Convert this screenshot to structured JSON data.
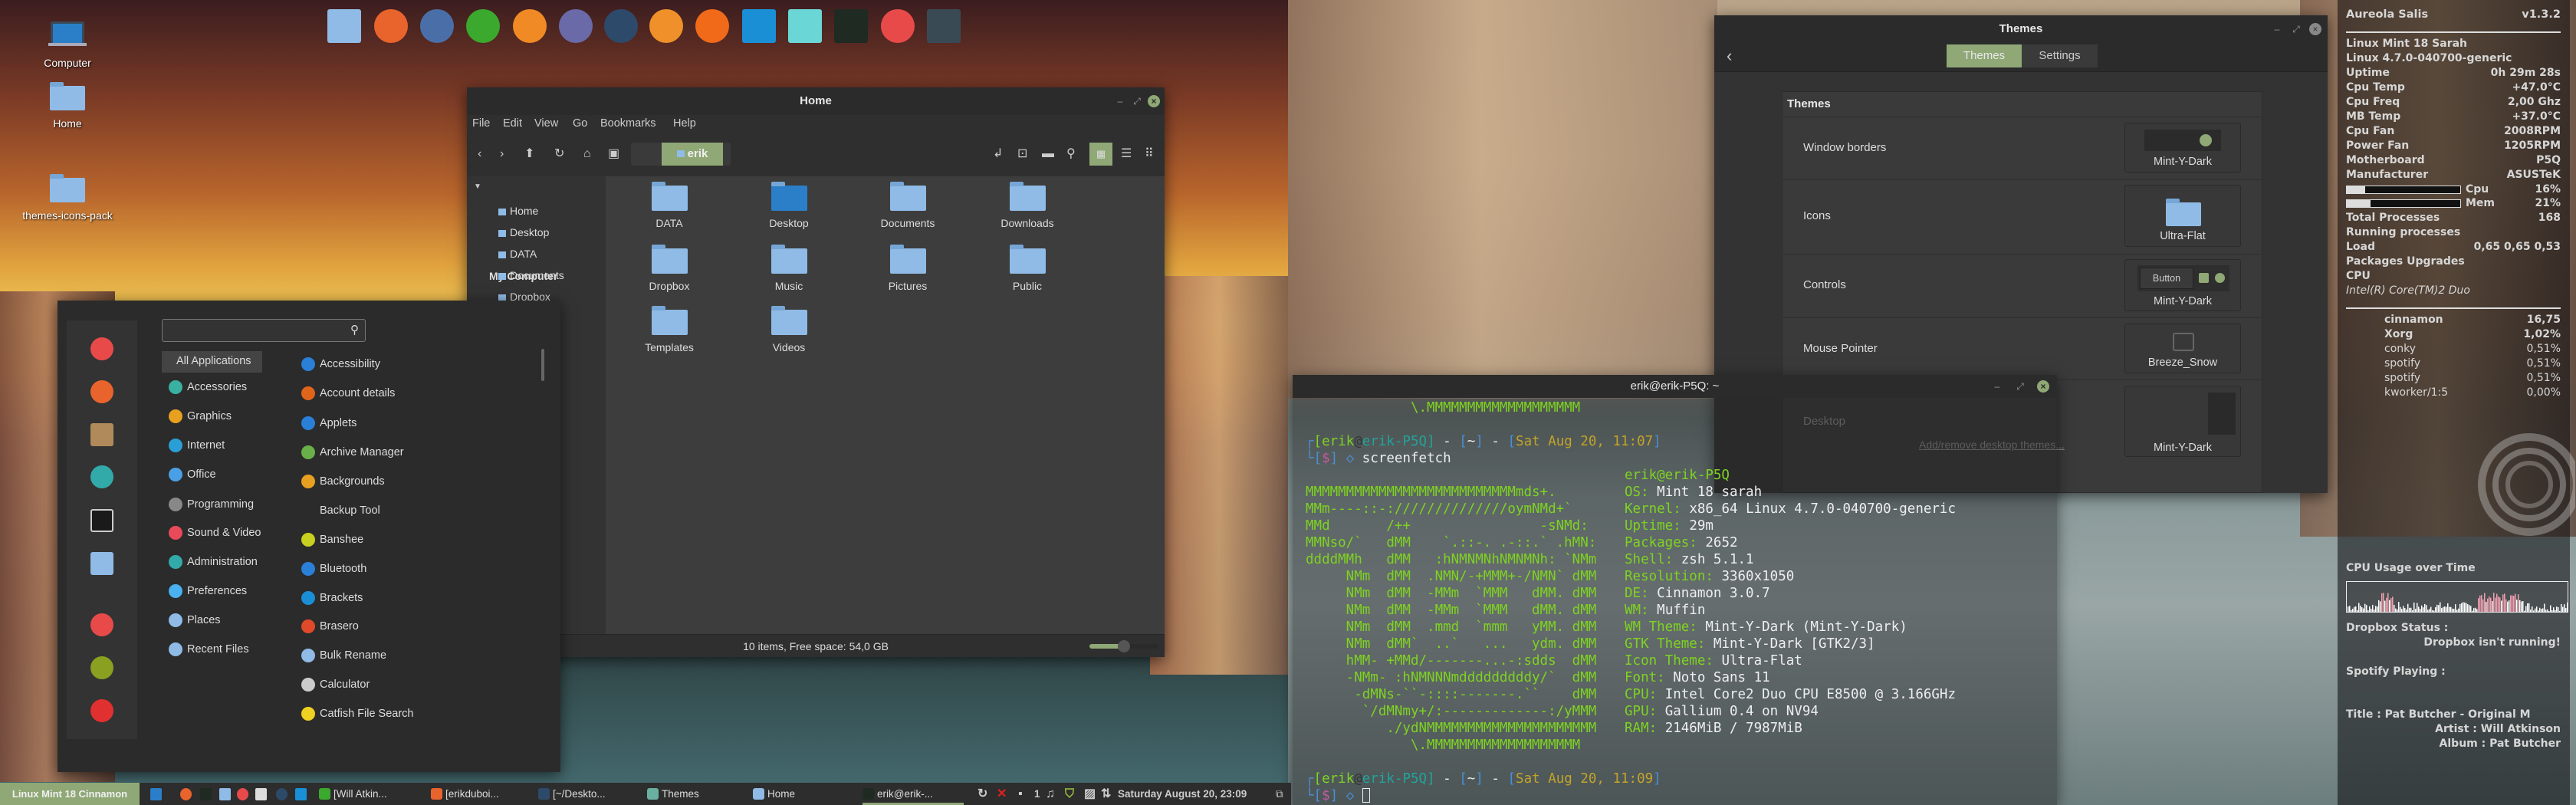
{
  "desktop_icons": [
    {
      "label": "Computer",
      "icon": "laptop-icon"
    },
    {
      "label": "Home",
      "icon": "home-folder-icon"
    },
    {
      "label": "themes-icons-pack",
      "icon": "folder-icon"
    }
  ],
  "dock": {
    "icons": [
      "files-icon",
      "firefox-icon",
      "text-editor-icon",
      "spotify-icon",
      "gimp-icon",
      "inkscape-icon",
      "sublime-text-icon",
      "clementine-icon",
      "vlc-icon",
      "brackets-icon",
      "screenshot-icon",
      "system-monitor-icon",
      "chromium-icon",
      "terminal-icon"
    ],
    "colors": [
      "#8fbbe6",
      "#e8642c",
      "#4a6fa8",
      "#3ba82e",
      "#f08a24",
      "#6a6aa8",
      "#2e4a6a",
      "#f0902a",
      "#f06a1a",
      "#1a8fd6",
      "#6ad6d6",
      "#1e2a22",
      "#e84a4a",
      "#3a4a55"
    ]
  },
  "file_manager": {
    "title": "Home",
    "menu": [
      "File",
      "Edit",
      "View",
      "Go",
      "Bookmarks",
      "Help"
    ],
    "path_button": "erik",
    "sidebar_header": "My Computer",
    "sidebar_items": [
      "Home",
      "Desktop",
      "DATA",
      "Documents",
      "Dropbox"
    ],
    "items": [
      "DATA",
      "Desktop",
      "Documents",
      "Downloads",
      "Dropbox",
      "Music",
      "Pictures",
      "Public",
      "Templates",
      "Videos"
    ],
    "status": "10 items, Free space: 54,0 GB",
    "zoom_level_percent": 50,
    "accent": "#8fa876"
  },
  "menu": {
    "search_placeholder": "",
    "favorites": [
      "chromium-icon",
      "firefox-icon",
      "package-manager-icon",
      "settings-icon",
      "terminal-icon",
      "files-icon",
      "lock-screen-icon",
      "logout-icon",
      "shutdown-icon"
    ],
    "categories": [
      "All Applications",
      "Accessories",
      "Graphics",
      "Internet",
      "Office",
      "Programming",
      "Sound & Video",
      "Administration",
      "Preferences",
      "Places",
      "Recent Files"
    ],
    "apps": [
      "Accessibility",
      "Account details",
      "Applets",
      "Archive Manager",
      "Backgrounds",
      "Backup Tool",
      "Banshee",
      "Bluetooth",
      "Brackets",
      "Brasero",
      "Bulk Rename",
      "Calculator",
      "Catfish File Search"
    ]
  },
  "terminal": {
    "title": "erik@erik-P5Q: ~",
    "previous_output": "             \\.MMMMMMMMMMMMMMMMMMM",
    "prompts": [
      {
        "user": "erik",
        "at": "@",
        "host": "erik-P5Q",
        "dir": "~",
        "time": "Sat Aug 20, 11:07",
        "symbol": "$",
        "command": "screenfetch"
      },
      {
        "user": "erik",
        "at": "@",
        "host": "erik-P5Q",
        "dir": "~",
        "time": "Sat Aug 20, 11:09",
        "symbol": "$",
        "command": ""
      }
    ],
    "info_header": "erik@erik-P5Q",
    "art": [
      "MMMMMMMMMMMMMMMMMMMMMMMMMMmds+.",
      "MMm----::-://////////////oymNMd+`",
      "MMd       /++                -sNMd:",
      "MMNso/`   dMM    `.::-. .-::.` .hMN:",
      "ddddMMh   dMM   :hNMNMNhNMNMNh: `NMm",
      "     NMm  dMM  .NMN/-+MMM+-/NMN` dMM",
      "     NMm  dMM  -MMm  `MMM   dMM. dMM",
      "     NMm  dMM  -MMm  `MMM   dMM. dMM",
      "     NMm  dMM  .mmd  `mmm   yMM. dMM",
      "     NMm  dMM`  ..`   ...   ydm. dMM",
      "     hMM- +MMd/-------...-:sdds  dMM",
      "     -NMm- :hNMNNNmdddddddddy/`  dMM",
      "      -dMNs-``-::::-------.``    dMM",
      "       `/dMNmy+/:-------------:/yMMM",
      "          ./ydNMMMMMMMMMMMMMMMMMMMMM",
      "             \\.MMMMMMMMMMMMMMMMMMM"
    ],
    "info": [
      {
        "k": "OS:",
        "v": "Mint 18 sarah"
      },
      {
        "k": "Kernel:",
        "v": "x86_64 Linux 4.7.0-040700-generic"
      },
      {
        "k": "Uptime:",
        "v": "29m"
      },
      {
        "k": "Packages:",
        "v": "2652"
      },
      {
        "k": "Shell:",
        "v": "zsh 5.1.1"
      },
      {
        "k": "Resolution:",
        "v": "3360x1050"
      },
      {
        "k": "DE:",
        "v": "Cinnamon 3.0.7"
      },
      {
        "k": "WM:",
        "v": "Muffin"
      },
      {
        "k": "WM Theme:",
        "v": "Mint-Y-Dark (Mint-Y-Dark)"
      },
      {
        "k": "GTK Theme:",
        "v": "Mint-Y-Dark [GTK2/3]"
      },
      {
        "k": "Icon Theme:",
        "v": "Ultra-Flat"
      },
      {
        "k": "Font:",
        "v": "Noto Sans 11"
      },
      {
        "k": "CPU:",
        "v": "Intel Core2 Duo CPU E8500 @ 3.166GHz"
      },
      {
        "k": "GPU:",
        "v": "Gallium 0.4 on NV94"
      },
      {
        "k": "RAM:",
        "v": "2146MiB / 7987MiB"
      }
    ]
  },
  "themes": {
    "title": "Themes",
    "tabs": [
      "Themes",
      "Settings"
    ],
    "active_tab": "Themes",
    "section": "Themes",
    "rows": [
      {
        "label": "Window borders",
        "value": "Mint-Y-Dark"
      },
      {
        "label": "Icons",
        "value": "Ultra-Flat"
      },
      {
        "label": "Controls",
        "value": "Mint-Y-Dark"
      },
      {
        "label": "Mouse Pointer",
        "value": "Breeze_Snow"
      },
      {
        "label": "Desktop",
        "value": "Mint-Y-Dark"
      }
    ],
    "controls_preview_button": "Button",
    "add_remove_link": "Add/remove desktop themes..."
  },
  "conky": {
    "title": "Aureola Salis",
    "version": "v1.3.2",
    "distro": "Linux Mint 18 Sarah",
    "kernel": "Linux 4.7.0-040700-generic",
    "stats": [
      {
        "k": "Uptime",
        "v": "0h 29m 28s"
      },
      {
        "k": "Cpu Temp",
        "v": "+47.0°C"
      },
      {
        "k": "Cpu Freq",
        "v": "2,00 Ghz"
      },
      {
        "k": "MB Temp",
        "v": "+37.0°C"
      },
      {
        "k": "Cpu Fan",
        "v": "2008RPM"
      },
      {
        "k": "Power Fan",
        "v": "1205RPM"
      },
      {
        "k": "Motherboard",
        "v": "P5Q"
      },
      {
        "k": "Manufacturer",
        "v": "ASUSTeK"
      }
    ],
    "bars": [
      {
        "k": "Cpu",
        "v": "16%",
        "percent": 16
      },
      {
        "k": "Mem",
        "v": "21%",
        "percent": 21
      }
    ],
    "stats2": [
      {
        "k": "Total Processes",
        "v": "168"
      },
      {
        "k": "Running processes",
        "v": ""
      },
      {
        "k": "Load",
        "v": "0,65 0,65 0,53"
      },
      {
        "k": "Packages Upgrades",
        "v": ""
      },
      {
        "k": "CPU",
        "v": ""
      }
    ],
    "cpu_model": "Intel(R) Core(TM)2 Duo",
    "processes": [
      {
        "name": "cinnamon",
        "v": "16,75",
        "bold": true
      },
      {
        "name": "Xorg",
        "v": "1,02%",
        "bold": true
      },
      {
        "name": "conky",
        "v": "0,51%",
        "bold": false
      },
      {
        "name": "spotify",
        "v": "0,51%",
        "bold": false
      },
      {
        "name": "spotify",
        "v": "0,51%",
        "bold": false
      },
      {
        "name": "kworker/1:5",
        "v": "0,00%",
        "bold": false
      }
    ],
    "graph_label": "CPU Usage over Time",
    "dropbox_label": "Dropbox Status :",
    "dropbox_status": "Dropbox isn't running!",
    "spotify_label": "Spotify Playing :",
    "track_title": "Title : Pat Butcher - Original M",
    "track_artist": "Artist : Will Atkinson",
    "track_album": "Album : Pat Butcher"
  },
  "taskbar": {
    "menu_button": "Linux Mint 18 Cinnamon",
    "launchers": [
      "show-desktop-icon",
      "firefox-icon",
      "terminal-icon",
      "files-icon",
      "chromium-icon",
      "screenshot-icon",
      "sublime-text-icon",
      "brackets-icon"
    ],
    "windows": [
      {
        "label": "[Will Atkin...",
        "icon": "spotify-icon",
        "color": "#3ba82e"
      },
      {
        "label": "[erikduboi...",
        "icon": "firefox-icon",
        "color": "#e8642c"
      },
      {
        "label": "[~/Deskto...",
        "icon": "sublime-text-icon",
        "color": "#2e4a6a"
      },
      {
        "label": "Themes",
        "icon": "themes-icon",
        "color": "#6ab0a0"
      },
      {
        "label": "Home",
        "icon": "folder-icon",
        "color": "#8fbbe6"
      },
      {
        "label": "erik@erik-...",
        "icon": "terminal-icon",
        "color": "#1e2a22",
        "active": true
      }
    ],
    "tray": [
      "refresh-icon",
      "close-x-icon",
      "notifications-icon",
      "music-icon",
      "shield-icon",
      "image-icon",
      "network-icon"
    ],
    "notification_count": "1",
    "clock": "Saturday August 20, 23:09",
    "accent": "#8fa876"
  }
}
